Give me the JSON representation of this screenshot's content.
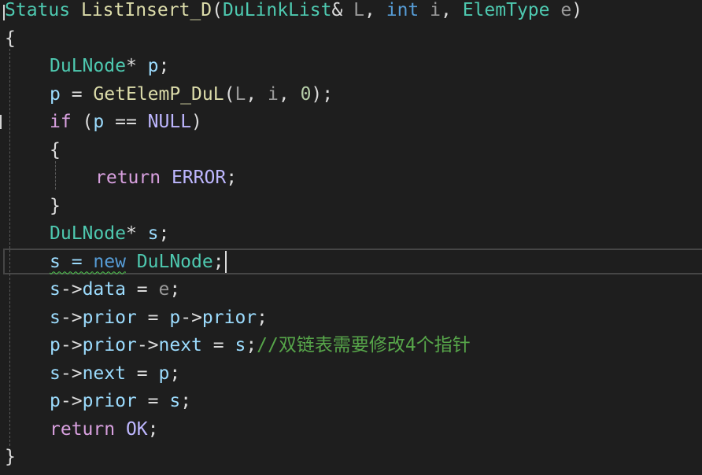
{
  "lines": [
    {
      "indent": 0,
      "tokens": [
        {
          "t": "Status",
          "c": "k-type"
        },
        {
          "t": " ",
          "c": "k-punct"
        },
        {
          "t": "ListInsert_D",
          "c": "k-func"
        },
        {
          "t": "(",
          "c": "k-punct"
        },
        {
          "t": "DuLinkList",
          "c": "k-type"
        },
        {
          "t": "& ",
          "c": "k-punct"
        },
        {
          "t": "L",
          "c": "k-param"
        },
        {
          "t": ", ",
          "c": "k-punct"
        },
        {
          "t": "int",
          "c": "k-kw"
        },
        {
          "t": " ",
          "c": "k-punct"
        },
        {
          "t": "i",
          "c": "k-param"
        },
        {
          "t": ", ",
          "c": "k-punct"
        },
        {
          "t": "ElemType",
          "c": "k-type"
        },
        {
          "t": " ",
          "c": "k-punct"
        },
        {
          "t": "e",
          "c": "k-param"
        },
        {
          "t": ")",
          "c": "k-punct"
        }
      ]
    },
    {
      "indent": 0,
      "tokens": [
        {
          "t": "{",
          "c": "k-punct"
        }
      ]
    },
    {
      "indent": 1,
      "tokens": [
        {
          "t": "DuLNode",
          "c": "k-type"
        },
        {
          "t": "* ",
          "c": "k-punct"
        },
        {
          "t": "p",
          "c": "k-var"
        },
        {
          "t": ";",
          "c": "k-punct"
        }
      ]
    },
    {
      "indent": 1,
      "tokens": [
        {
          "t": "p",
          "c": "k-var"
        },
        {
          "t": " = ",
          "c": "k-punct"
        },
        {
          "t": "GetElemP_DuL",
          "c": "k-func"
        },
        {
          "t": "(",
          "c": "k-punct"
        },
        {
          "t": "L",
          "c": "k-param"
        },
        {
          "t": ", ",
          "c": "k-punct"
        },
        {
          "t": "i",
          "c": "k-param"
        },
        {
          "t": ", ",
          "c": "k-punct"
        },
        {
          "t": "0",
          "c": "k-num"
        },
        {
          "t": ");",
          "c": "k-punct"
        }
      ]
    },
    {
      "indent": 1,
      "tokens": [
        {
          "t": "if",
          "c": "k-ctrl"
        },
        {
          "t": " (",
          "c": "k-punct"
        },
        {
          "t": "p",
          "c": "k-var"
        },
        {
          "t": " == ",
          "c": "k-punct"
        },
        {
          "t": "NULL",
          "c": "k-macro"
        },
        {
          "t": ")",
          "c": "k-punct"
        }
      ]
    },
    {
      "indent": 1,
      "tokens": [
        {
          "t": "{",
          "c": "k-punct"
        }
      ]
    },
    {
      "indent": 2,
      "tokens": [
        {
          "t": "return",
          "c": "k-ctrl"
        },
        {
          "t": " ",
          "c": "k-punct"
        },
        {
          "t": "ERROR",
          "c": "k-macro"
        },
        {
          "t": ";",
          "c": "k-punct"
        }
      ]
    },
    {
      "indent": 1,
      "tokens": [
        {
          "t": "}",
          "c": "k-punct"
        }
      ]
    },
    {
      "indent": 1,
      "tokens": [
        {
          "t": "DuLNode",
          "c": "k-type"
        },
        {
          "t": "* ",
          "c": "k-punct"
        },
        {
          "t": "s",
          "c": "k-var"
        },
        {
          "t": ";",
          "c": "k-punct"
        }
      ]
    },
    {
      "indent": 1,
      "current": true,
      "tokens": [
        {
          "t": "s = ",
          "c": "k-var",
          "squiggle": true
        },
        {
          "t": "new",
          "c": "k-kw",
          "squiggle": true
        },
        {
          "t": " ",
          "c": "k-punct"
        },
        {
          "t": "DuLNode",
          "c": "k-type"
        },
        {
          "t": ";",
          "c": "k-punct"
        }
      ]
    },
    {
      "indent": 1,
      "tokens": [
        {
          "t": "s",
          "c": "k-var"
        },
        {
          "t": "->",
          "c": "k-punct"
        },
        {
          "t": "data",
          "c": "k-var"
        },
        {
          "t": " = ",
          "c": "k-punct"
        },
        {
          "t": "e",
          "c": "k-param"
        },
        {
          "t": ";",
          "c": "k-punct"
        }
      ]
    },
    {
      "indent": 1,
      "tokens": [
        {
          "t": "s",
          "c": "k-var"
        },
        {
          "t": "->",
          "c": "k-punct"
        },
        {
          "t": "prior",
          "c": "k-var"
        },
        {
          "t": " = ",
          "c": "k-punct"
        },
        {
          "t": "p",
          "c": "k-var"
        },
        {
          "t": "->",
          "c": "k-punct"
        },
        {
          "t": "prior",
          "c": "k-var"
        },
        {
          "t": ";",
          "c": "k-punct"
        }
      ]
    },
    {
      "indent": 1,
      "tokens": [
        {
          "t": "p",
          "c": "k-var"
        },
        {
          "t": "->",
          "c": "k-punct"
        },
        {
          "t": "prior",
          "c": "k-var"
        },
        {
          "t": "->",
          "c": "k-punct"
        },
        {
          "t": "next",
          "c": "k-var"
        },
        {
          "t": " = ",
          "c": "k-punct"
        },
        {
          "t": "s",
          "c": "k-var"
        },
        {
          "t": ";",
          "c": "k-punct"
        },
        {
          "t": "//双链表需要修改4个指针",
          "c": "k-comment"
        }
      ]
    },
    {
      "indent": 1,
      "tokens": [
        {
          "t": "s",
          "c": "k-var"
        },
        {
          "t": "->",
          "c": "k-punct"
        },
        {
          "t": "next",
          "c": "k-var"
        },
        {
          "t": " = ",
          "c": "k-punct"
        },
        {
          "t": "p",
          "c": "k-var"
        },
        {
          "t": ";",
          "c": "k-punct"
        }
      ]
    },
    {
      "indent": 1,
      "tokens": [
        {
          "t": "p",
          "c": "k-var"
        },
        {
          "t": "->",
          "c": "k-punct"
        },
        {
          "t": "prior",
          "c": "k-var"
        },
        {
          "t": " = ",
          "c": "k-punct"
        },
        {
          "t": "s",
          "c": "k-var"
        },
        {
          "t": ";",
          "c": "k-punct"
        }
      ]
    },
    {
      "indent": 1,
      "tokens": [
        {
          "t": "return",
          "c": "k-ctrl"
        },
        {
          "t": " ",
          "c": "k-punct"
        },
        {
          "t": "OK",
          "c": "k-macro"
        },
        {
          "t": ";",
          "c": "k-punct"
        }
      ]
    },
    {
      "indent": 0,
      "tokens": [
        {
          "t": "}",
          "c": "k-punct"
        }
      ]
    }
  ],
  "colors": {
    "background": "#1e1e1e",
    "type": "#4ec9b0",
    "keyword": "#569cd6",
    "control": "#d8a0df",
    "function": "#dcdcaa",
    "variable": "#9cdcfe",
    "parameter": "#9a9a9a",
    "macro": "#beb7ff",
    "number": "#b5cea8",
    "comment": "#57a64a"
  }
}
